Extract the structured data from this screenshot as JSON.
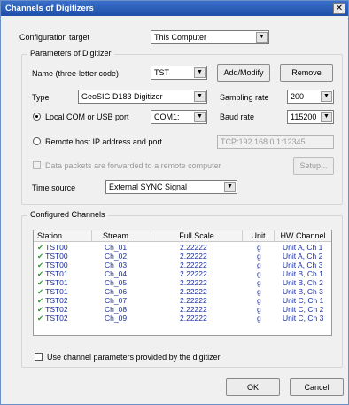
{
  "window": {
    "title": "Channels of Digitizers",
    "close_glyph": "✕"
  },
  "config": {
    "label": "Configuration target",
    "value": "This Computer"
  },
  "params": {
    "group_title": "Parameters of Digitizer",
    "name_label": "Name (three-letter code)",
    "name_value": "TST",
    "add_modify": "Add/Modify",
    "remove": "Remove",
    "type_label": "Type",
    "type_value": "GeoSIG D183 Digitizer",
    "sampling_label": "Sampling rate",
    "sampling_value": "200",
    "local_port_label": "Local COM or USB port",
    "local_port_value": "COM1:",
    "baud_label": "Baud rate",
    "baud_value": "115200",
    "remote_label": "Remote host IP address and port",
    "remote_value": "TCP:192.168.0.1:12345",
    "forward_label": "Data packets are forwarded to a remote computer",
    "setup": "Setup...",
    "time_label": "Time source",
    "time_value": "External SYNC Signal"
  },
  "channels": {
    "group_title": "Configured Channels",
    "headers": [
      "Station",
      "Stream",
      "Full Scale",
      "Unit",
      "HW Channel"
    ],
    "check_glyph": "✔",
    "rows": [
      [
        "TST00",
        "Ch_01",
        "2.22222",
        "g",
        "Unit A, Ch 1"
      ],
      [
        "TST00",
        "Ch_02",
        "2.22222",
        "g",
        "Unit A, Ch 2"
      ],
      [
        "TST00",
        "Ch_03",
        "2.22222",
        "g",
        "Unit A, Ch 3"
      ],
      [
        "TST01",
        "Ch_04",
        "2.22222",
        "g",
        "Unit B, Ch 1"
      ],
      [
        "TST01",
        "Ch_05",
        "2.22222",
        "g",
        "Unit B, Ch 2"
      ],
      [
        "TST01",
        "Ch_06",
        "2.22222",
        "g",
        "Unit B, Ch 3"
      ],
      [
        "TST02",
        "Ch_07",
        "2.22222",
        "g",
        "Unit C, Ch 1"
      ],
      [
        "TST02",
        "Ch_08",
        "2.22222",
        "g",
        "Unit C, Ch 2"
      ],
      [
        "TST02",
        "Ch_09",
        "2.22222",
        "g",
        "Unit C, Ch 3"
      ]
    ],
    "use_params_label": "Use channel parameters provided by the digitizer"
  },
  "footer": {
    "ok": "OK",
    "cancel": "Cancel"
  },
  "icons": {
    "dropdown": "▼"
  },
  "colors": {
    "title_bar": "#1f4fa8",
    "row_text": "#1b2fa0",
    "check": "#2aa02a"
  }
}
